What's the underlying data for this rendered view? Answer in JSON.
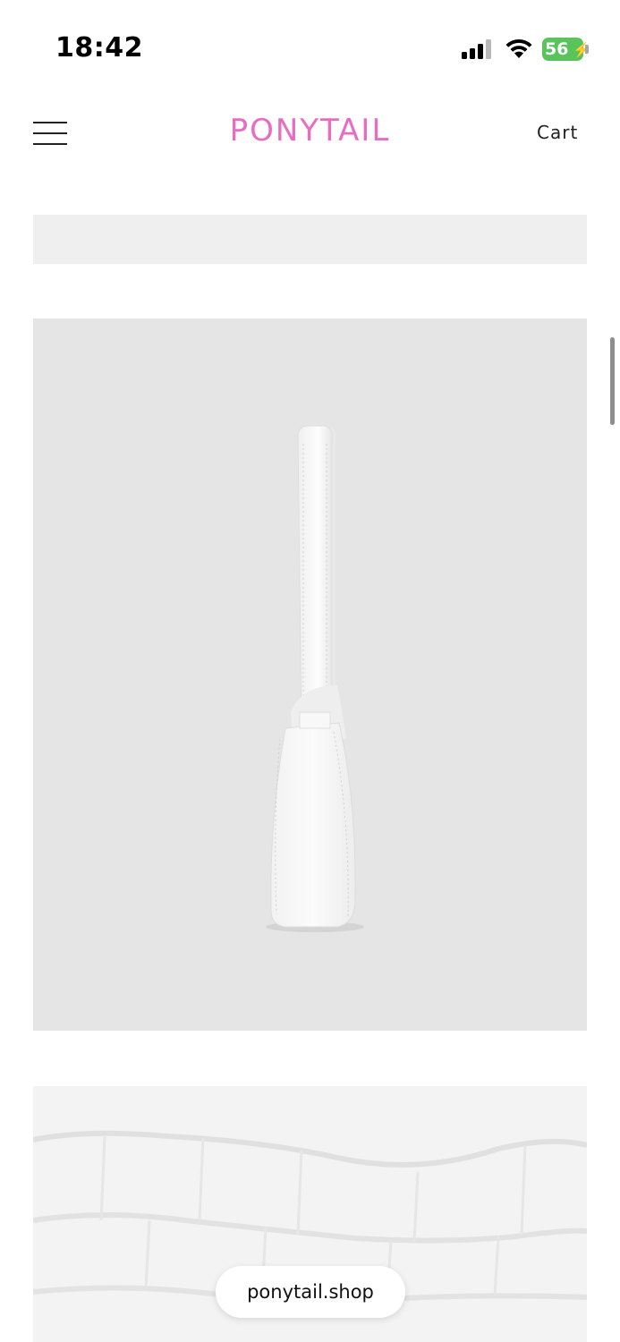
{
  "status_bar": {
    "time": "18:42",
    "battery_level": "56",
    "battery_color": "#5ac35b",
    "signal_icon": "cellular-signal-icon",
    "wifi_icon": "wifi-icon",
    "battery_icon": "battery-charging-icon"
  },
  "header": {
    "menu_icon": "hamburger-menu-icon",
    "logo": "PONYTAIL",
    "logo_color": "#e86cc0",
    "cart_label": "Cart"
  },
  "product_images": [
    {
      "description": "product image (partially visible)"
    },
    {
      "description": "white croc-embossed shoulder bag, side view"
    },
    {
      "description": "close-up of white croc-embossed leather texture"
    }
  ],
  "browser": {
    "url": "ponytail.shop"
  }
}
